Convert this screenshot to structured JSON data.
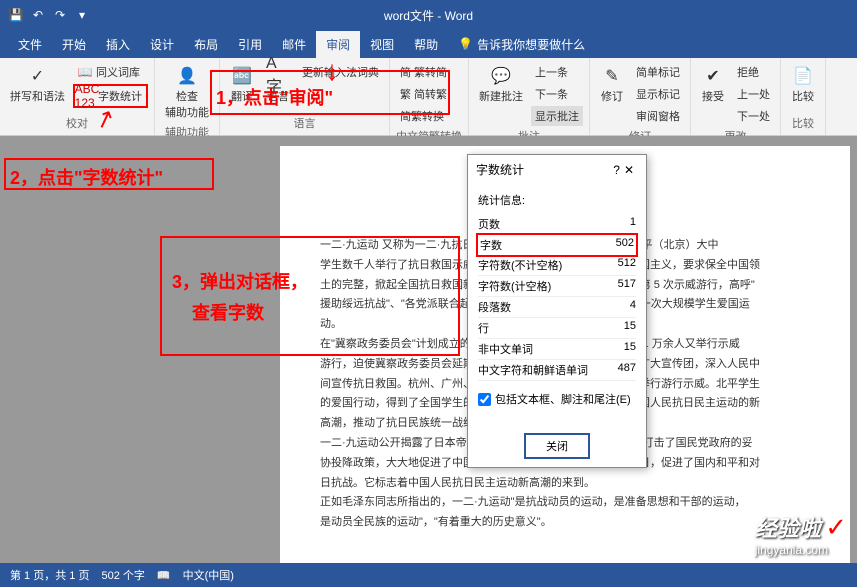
{
  "titlebar": {
    "title": "word文件 - Word"
  },
  "menubar": {
    "items": [
      "文件",
      "开始",
      "插入",
      "设计",
      "布局",
      "引用",
      "邮件",
      "审阅",
      "视图",
      "帮助"
    ],
    "active_index": 7,
    "tell_me": "告诉我你想要做什么"
  },
  "ribbon": {
    "groups": {
      "proofing": {
        "label": "校对",
        "spelling": "拼写和语法",
        "thesaurus": "同义词库",
        "wordcount": "字数统计"
      },
      "accessibility": {
        "label": "辅助功能",
        "check": "检查",
        "sub": "辅助功能"
      },
      "language": {
        "label": "语言",
        "translate": "翻译",
        "lang": "语言",
        "new_word": "更新输入法词典"
      },
      "cn": {
        "label": "中文简繁转换",
        "s2t": "简 繁转简",
        "t2s": "繁 简转繁",
        "conv": "简繁转换"
      },
      "comments": {
        "label": "批注",
        "new": "新建批注",
        "prev": "上一条",
        "next": "下一条",
        "show": "显示批注"
      },
      "tracking": {
        "label": "修订",
        "track": "修订",
        "simple": "简单标记",
        "show_markup": "显示标记",
        "pane": "审阅窗格"
      },
      "changes": {
        "label": "更改",
        "accept": "接受",
        "reject": "拒绝",
        "prev": "上一处",
        "next": "下一处"
      },
      "compare": {
        "label": "比较",
        "btn": "比较"
      }
    }
  },
  "dialog": {
    "title": "字数统计",
    "help": "?",
    "subtitle": "统计信息:",
    "stats": [
      {
        "label": "页数",
        "value": "1"
      },
      {
        "label": "字数",
        "value": "502",
        "highlight": true
      },
      {
        "label": "字符数(不计空格)",
        "value": "512"
      },
      {
        "label": "字符数(计空格)",
        "value": "517"
      },
      {
        "label": "段落数",
        "value": "4"
      },
      {
        "label": "行",
        "value": "15"
      },
      {
        "label": "非中文单词",
        "value": "15"
      },
      {
        "label": "中文字符和朝鲜语单词",
        "value": "487"
      }
    ],
    "checkbox": "包括文本框、脚注和尾注(E)",
    "close": "关闭"
  },
  "annotations": {
    "a1": "1，点击\"审阅\"",
    "a2": "2，点击\"字数统计\"",
    "a3a": "3，弹出对话框，",
    "a3b": "查看字数"
  },
  "document": {
    "lines": [
      "一二·九运动    又称为一二·九抗日救亡运动。1935 年 12 月 9 日，北平（北京）大中",
      "学生数千人举行了抗日救国示威游行，反对华北自治，反抗日本帝国主义，要求保全中国领",
      "土的完整，掀起全国抗日救国新高潮。12 月 12 日，北平学生举行第 5 次示威游行，高呼\"",
      "援助绥远抗战\"、\"各党派联合起来\"等口号。这是中国共产党领导的一次大规模学生爱国运",
      "动。",
      "在\"冀察政务委员会\"计划成立的 12 月 16 日，北平学生和各界群众 1 万余人又举行示威",
      "游行，迫使冀察政务委员会延期成立。之后，天津学生又组成南下扩大宣传团，深入人民中",
      "间宣传抗日救国。杭州、广州、武汉、天津、南京、上海等地相继举行游行示威。北平学生",
      "的爱国行动，得到了全国学生的响应和全国人民的支持，形成了全国人民抗日民主运动的新",
      "高潮，推动了抗日民族统一战线的建立。",
      "一二·九运动公开揭露了日本帝国主义侵略中国，并吞华北的阴谋，打击了国民党政府的妥",
      "协投降政策，大大地促进了中国人民的觉醒。它配合了红军北上抗日，促进了国内和平和对",
      "日抗战。它标志着中国人民抗日民主运动新高潮的来到。",
      "正如毛泽东同志所指出的，一二·九运动\"是抗战动员的运动，是准备思想和干部的运动，",
      "是动员全民族的运动\"，\"有着重大的历史意义\"。"
    ]
  },
  "statusbar": {
    "page": "第 1 页，共 1 页",
    "words": "502 个字",
    "lang": "中文(中国)"
  },
  "watermark": {
    "main": "经验啦",
    "url": "jingyanla.com"
  }
}
